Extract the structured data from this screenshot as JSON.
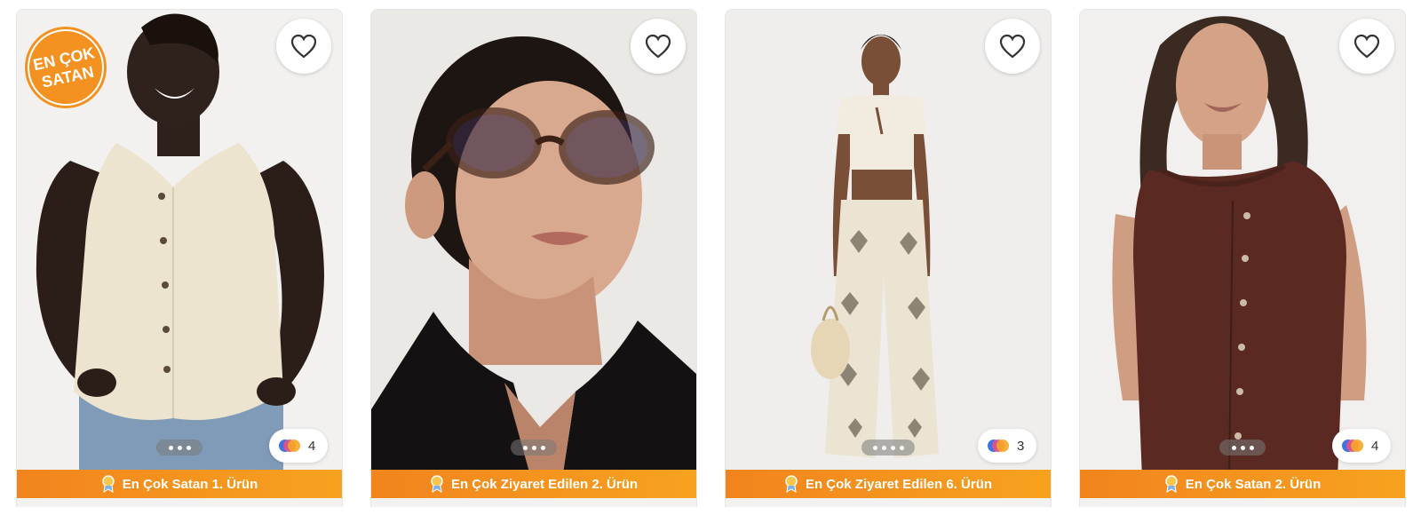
{
  "products": [
    {
      "bestseller_badge": "EN ÇOK SATAN",
      "favorite_icon": "heart-outline-icon",
      "color_count": "4",
      "rank_label": "En Çok Satan 1. Ürün",
      "image_dots": 3
    },
    {
      "favorite_icon": "heart-outline-icon",
      "rank_label": "En Çok Ziyaret Edilen 2. Ürün",
      "image_dots": 3
    },
    {
      "favorite_icon": "heart-outline-icon",
      "color_count": "3",
      "rank_label": "En Çok Ziyaret Edilen 6. Ürün",
      "image_dots": 4
    },
    {
      "favorite_icon": "heart-outline-icon",
      "color_count": "4",
      "rank_label": "En Çok Satan 2. Ürün",
      "image_dots": 3
    }
  ],
  "colors": {
    "rank_strip_start": "#f2841e",
    "rank_strip_end": "#f7a21f",
    "badge_orange": "#f39121"
  }
}
